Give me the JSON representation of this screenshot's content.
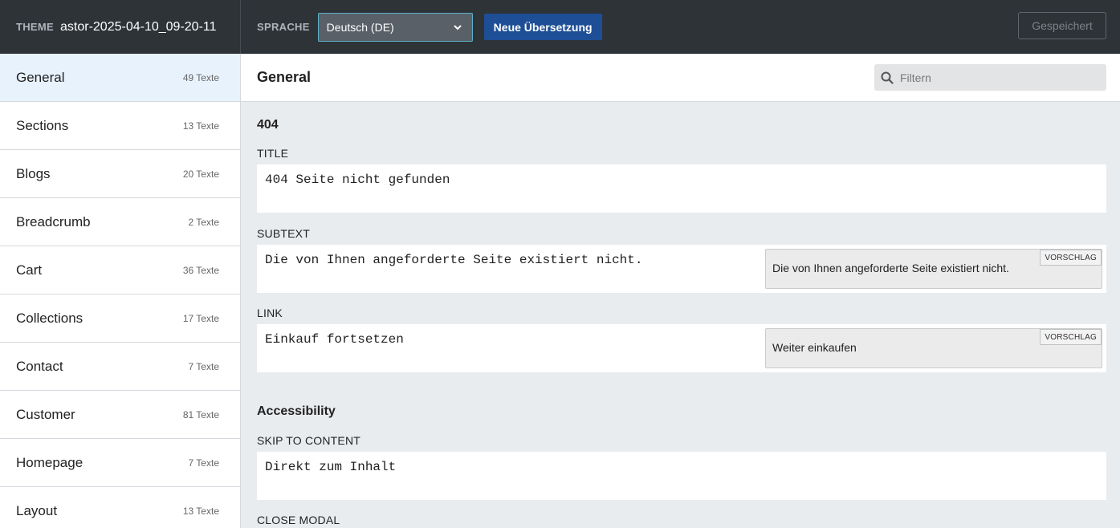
{
  "topbar": {
    "theme_label": "THEME",
    "theme_name": "astor-2025-04-10_09-20-11",
    "language_label": "SPRACHE",
    "language_selected": "Deutsch (DE)",
    "new_translation_label": "Neue Übersetzung",
    "saved_label": "Gespeichert"
  },
  "sidebar": {
    "items": [
      {
        "name": "General",
        "count": "49 Texte"
      },
      {
        "name": "Sections",
        "count": "13 Texte"
      },
      {
        "name": "Blogs",
        "count": "20 Texte"
      },
      {
        "name": "Breadcrumb",
        "count": "2 Texte"
      },
      {
        "name": "Cart",
        "count": "36 Texte"
      },
      {
        "name": "Collections",
        "count": "17 Texte"
      },
      {
        "name": "Contact",
        "count": "7 Texte"
      },
      {
        "name": "Customer",
        "count": "81 Texte"
      },
      {
        "name": "Homepage",
        "count": "7 Texte"
      },
      {
        "name": "Layout",
        "count": "13 Texte"
      }
    ]
  },
  "main": {
    "title": "General",
    "filter_placeholder": "Filtern",
    "sections": [
      {
        "title": "404",
        "fields": [
          {
            "label": "TITLE",
            "value": "404 Seite nicht gefunden"
          },
          {
            "label": "SUBTEXT",
            "value": "Die von Ihnen angeforderte Seite existiert nicht.",
            "suggestion": "Die von Ihnen angeforderte Seite existiert nicht.",
            "suggestion_badge": "VORSCHLAG"
          },
          {
            "label": "LINK",
            "value": "Einkauf fortsetzen",
            "suggestion": "Weiter einkaufen",
            "suggestion_badge": "VORSCHLAG"
          }
        ]
      },
      {
        "title": "Accessibility",
        "fields": [
          {
            "label": "SKIP TO CONTENT",
            "value": "Direkt zum Inhalt"
          },
          {
            "label": "CLOSE MODAL",
            "value": ""
          }
        ]
      }
    ]
  },
  "icons": {
    "search": "search-icon",
    "chevron": "chevron-down-icon"
  }
}
